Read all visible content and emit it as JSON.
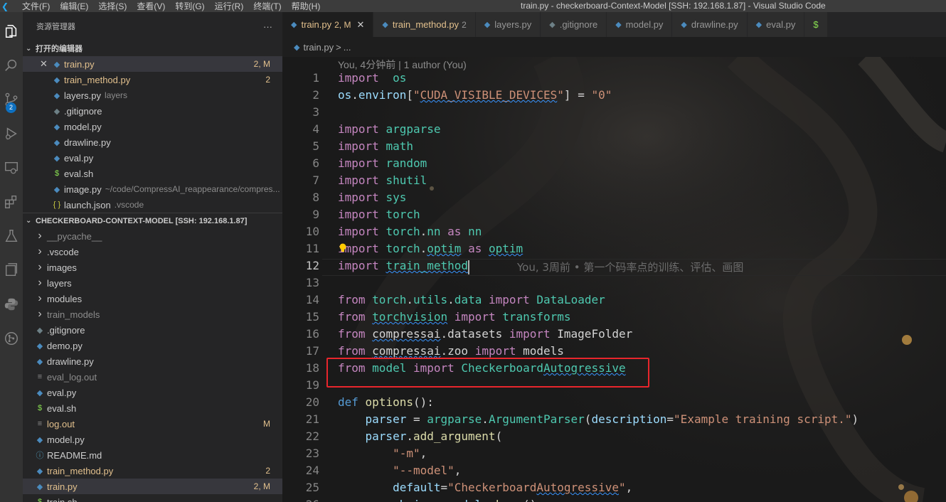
{
  "titlebar": {
    "logo": "vscode-logo",
    "menu": [
      "文件(F)",
      "编辑(E)",
      "选择(S)",
      "查看(V)",
      "转到(G)",
      "运行(R)",
      "终端(T)",
      "帮助(H)"
    ],
    "window_title": "train.py - checkerboard-Context-Model [SSH: 192.168.1.87] - Visual Studio Code"
  },
  "activity": {
    "icons": [
      "files-icon",
      "search-icon",
      "source-control-icon",
      "run-debug-icon",
      "remote-explorer-icon",
      "extensions-icon",
      "testing-icon",
      "jupyter-icon",
      "python-icon",
      "gitlens-icon"
    ],
    "scm_badge": "2"
  },
  "sidebar": {
    "title": "资源管理器",
    "more": "···",
    "open_editors_title": "打开的编辑器",
    "open_editors": [
      {
        "name": "train.py",
        "desc": "",
        "status": "2, M",
        "kind": "py",
        "color": "mod",
        "close": "✕",
        "selected": true
      },
      {
        "name": "train_method.py",
        "desc": "",
        "status": "2",
        "kind": "py",
        "color": "mod"
      },
      {
        "name": "layers.py",
        "desc": "layers",
        "status": "",
        "kind": "py",
        "color": ""
      },
      {
        "name": ".gitignore",
        "desc": "",
        "status": "",
        "kind": "git",
        "color": ""
      },
      {
        "name": "model.py",
        "desc": "",
        "status": "",
        "kind": "py",
        "color": ""
      },
      {
        "name": "drawline.py",
        "desc": "",
        "status": "",
        "kind": "py",
        "color": ""
      },
      {
        "name": "eval.py",
        "desc": "",
        "status": "",
        "kind": "py",
        "color": ""
      },
      {
        "name": "eval.sh",
        "desc": "",
        "status": "",
        "kind": "sh",
        "color": ""
      },
      {
        "name": "image.py",
        "desc": "~/code/CompressAI_reappearance/compres...",
        "status": "",
        "kind": "py",
        "color": ""
      },
      {
        "name": "launch.json",
        "desc": ".vscode",
        "status": "",
        "kind": "json",
        "color": ""
      }
    ],
    "workspace_title": "CHECKERBOARD-CONTEXT-MODEL [SSH: 192.168.1.87]",
    "workspace": [
      {
        "name": "__pycache__",
        "kind": "folder",
        "color": "dim",
        "status": ""
      },
      {
        "name": ".vscode",
        "kind": "folder",
        "color": "",
        "status": ""
      },
      {
        "name": "images",
        "kind": "folder",
        "color": "",
        "status": ""
      },
      {
        "name": "layers",
        "kind": "folder",
        "color": "",
        "status": ""
      },
      {
        "name": "modules",
        "kind": "folder",
        "color": "",
        "status": ""
      },
      {
        "name": "train_models",
        "kind": "folder",
        "color": "dim",
        "status": ""
      },
      {
        "name": ".gitignore",
        "kind": "git",
        "color": "",
        "status": ""
      },
      {
        "name": "demo.py",
        "kind": "py",
        "color": "",
        "status": ""
      },
      {
        "name": "drawline.py",
        "kind": "py",
        "color": "",
        "status": ""
      },
      {
        "name": "eval_log.out",
        "kind": "txt",
        "color": "dim",
        "status": ""
      },
      {
        "name": "eval.py",
        "kind": "py",
        "color": "",
        "status": ""
      },
      {
        "name": "eval.sh",
        "kind": "sh",
        "color": "",
        "status": ""
      },
      {
        "name": "log.out",
        "kind": "txt",
        "color": "mod",
        "status": "M"
      },
      {
        "name": "model.py",
        "kind": "py",
        "color": "",
        "status": ""
      },
      {
        "name": "README.md",
        "kind": "info",
        "color": "",
        "status": ""
      },
      {
        "name": "train_method.py",
        "kind": "py",
        "color": "mod",
        "status": "2"
      },
      {
        "name": "train.py",
        "kind": "py",
        "color": "mod",
        "status": "2, M",
        "selected": true
      },
      {
        "name": "train.sh",
        "kind": "sh",
        "color": "",
        "status": ""
      }
    ]
  },
  "tabs": [
    {
      "label": "train.py",
      "status": "2, M",
      "close": "✕",
      "kind": "py",
      "active": true
    },
    {
      "label": "train_method.py",
      "status": "2",
      "kind": "py"
    },
    {
      "label": "layers.py",
      "status": "",
      "kind": "py"
    },
    {
      "label": ".gitignore",
      "status": "",
      "kind": "git"
    },
    {
      "label": "model.py",
      "status": "",
      "kind": "py"
    },
    {
      "label": "drawline.py",
      "status": "",
      "kind": "py"
    },
    {
      "label": "eval.py",
      "status": "",
      "kind": "py"
    },
    {
      "label": "$",
      "status": "",
      "kind": "sh"
    }
  ],
  "breadcrumb": {
    "file": "train.py",
    "sep": ">",
    "rest": "..."
  },
  "editor": {
    "codelens": "You, 4分钟前 | 1 author (You)",
    "blame": "You, 3周前 • 第一个码率点的训练、评估、画图",
    "current_line": 12,
    "lines": [
      {
        "n": "1",
        "t": [
          [
            "kw",
            "import"
          ],
          [
            "",
            "  "
          ],
          [
            "mod-n",
            "os"
          ]
        ]
      },
      {
        "n": "2",
        "t": [
          [
            "var",
            "os"
          ],
          [
            "",
            "."
          ],
          [
            "var",
            "environ"
          ],
          [
            "",
            "["
          ],
          [
            "str",
            "\""
          ],
          [
            "str sq",
            "CUDA_VISIBLE_DEVICES"
          ],
          [
            "str",
            "\""
          ],
          [
            "",
            "] = "
          ],
          [
            "str",
            "\"0\""
          ]
        ]
      },
      {
        "n": "3",
        "t": []
      },
      {
        "n": "4",
        "t": [
          [
            "kw",
            "import"
          ],
          [
            "",
            " "
          ],
          [
            "mod-n",
            "argparse"
          ]
        ]
      },
      {
        "n": "5",
        "t": [
          [
            "kw",
            "import"
          ],
          [
            "",
            " "
          ],
          [
            "mod-n",
            "math"
          ]
        ]
      },
      {
        "n": "6",
        "t": [
          [
            "kw",
            "import"
          ],
          [
            "",
            " "
          ],
          [
            "mod-n",
            "random"
          ]
        ]
      },
      {
        "n": "7",
        "t": [
          [
            "kw",
            "import"
          ],
          [
            "",
            " "
          ],
          [
            "mod-n",
            "shutil"
          ]
        ]
      },
      {
        "n": "8",
        "t": [
          [
            "kw",
            "import"
          ],
          [
            "",
            " "
          ],
          [
            "mod-n",
            "sys"
          ]
        ]
      },
      {
        "n": "9",
        "t": [
          [
            "kw",
            "import"
          ],
          [
            "",
            " "
          ],
          [
            "mod-n",
            "torch"
          ]
        ]
      },
      {
        "n": "10",
        "t": [
          [
            "kw",
            "import"
          ],
          [
            "",
            " "
          ],
          [
            "mod-n",
            "torch"
          ],
          [
            "",
            "."
          ],
          [
            "mod-n",
            "nn"
          ],
          [
            "",
            " "
          ],
          [
            "kw",
            "as"
          ],
          [
            "",
            " "
          ],
          [
            "mod-n",
            "nn"
          ]
        ]
      },
      {
        "n": "11",
        "t": [
          [
            "kw",
            "import"
          ],
          [
            "",
            " "
          ],
          [
            "mod-n",
            "torch"
          ],
          [
            "",
            "."
          ],
          [
            "mod-n sq",
            "optim"
          ],
          [
            "",
            " "
          ],
          [
            "kw",
            "as"
          ],
          [
            "",
            " "
          ],
          [
            "mod-n sq",
            "optim"
          ]
        ]
      },
      {
        "n": "12",
        "t": [
          [
            "kw",
            "import"
          ],
          [
            "",
            " "
          ],
          [
            "mod-n sq",
            "train_method"
          ]
        ]
      },
      {
        "n": "13",
        "t": []
      },
      {
        "n": "14",
        "t": [
          [
            "kw",
            "from"
          ],
          [
            "",
            " "
          ],
          [
            "mod-n",
            "torch"
          ],
          [
            "",
            "."
          ],
          [
            "mod-n",
            "utils"
          ],
          [
            "",
            "."
          ],
          [
            "mod-n",
            "data"
          ],
          [
            "",
            " "
          ],
          [
            "kw",
            "import"
          ],
          [
            "",
            " "
          ],
          [
            "mod-n",
            "DataLoader"
          ]
        ]
      },
      {
        "n": "15",
        "t": [
          [
            "kw",
            "from"
          ],
          [
            "",
            " "
          ],
          [
            "mod-n sq",
            "torchvision"
          ],
          [
            "",
            " "
          ],
          [
            "kw",
            "import"
          ],
          [
            "",
            " "
          ],
          [
            "mod-n",
            "transforms"
          ]
        ]
      },
      {
        "n": "16",
        "t": [
          [
            "kw",
            "from"
          ],
          [
            "",
            " "
          ],
          [
            "sq",
            "compressai"
          ],
          [
            "",
            "."
          ],
          [
            "",
            "datasets"
          ],
          [
            "",
            " "
          ],
          [
            "kw",
            "import"
          ],
          [
            "",
            " ImageFolder"
          ]
        ]
      },
      {
        "n": "17",
        "t": [
          [
            "kw",
            "from"
          ],
          [
            "",
            " "
          ],
          [
            "sq",
            "compressai"
          ],
          [
            "",
            "."
          ],
          [
            "",
            "zoo"
          ],
          [
            "",
            " "
          ],
          [
            "kw",
            "import"
          ],
          [
            "",
            " models"
          ]
        ]
      },
      {
        "n": "18",
        "t": [
          [
            "kw",
            "from"
          ],
          [
            "",
            " "
          ],
          [
            "mod-n",
            "model"
          ],
          [
            "",
            " "
          ],
          [
            "kw",
            "import"
          ],
          [
            "",
            " "
          ],
          [
            "mod-n",
            "Checkerboard"
          ],
          [
            "mod-n sq",
            "Autogressive"
          ]
        ]
      },
      {
        "n": "19",
        "t": []
      },
      {
        "n": "20",
        "t": [
          [
            "kw2",
            "def"
          ],
          [
            "",
            " "
          ],
          [
            "fn",
            "options"
          ],
          [
            "",
            "():"
          ]
        ]
      },
      {
        "n": "21",
        "t": [
          [
            "",
            "    "
          ],
          [
            "var",
            "parser"
          ],
          [
            "",
            " = "
          ],
          [
            "mod-n",
            "argparse"
          ],
          [
            "",
            "."
          ],
          [
            "mod-n",
            "ArgumentParser"
          ],
          [
            "",
            "("
          ],
          [
            "var",
            "description"
          ],
          [
            "",
            "="
          ],
          [
            "str",
            "\"Example training script.\""
          ],
          [
            "",
            ")"
          ]
        ]
      },
      {
        "n": "22",
        "t": [
          [
            "",
            "    "
          ],
          [
            "var",
            "parser"
          ],
          [
            "",
            "."
          ],
          [
            "fn",
            "add_argument"
          ],
          [
            "",
            "("
          ]
        ]
      },
      {
        "n": "23",
        "t": [
          [
            "",
            "        "
          ],
          [
            "str",
            "\"-m\""
          ],
          [
            "",
            ","
          ]
        ]
      },
      {
        "n": "24",
        "t": [
          [
            "",
            "        "
          ],
          [
            "str",
            "\"--model\""
          ],
          [
            "",
            ","
          ]
        ]
      },
      {
        "n": "25",
        "t": [
          [
            "",
            "        "
          ],
          [
            "var",
            "default"
          ],
          [
            "",
            "="
          ],
          [
            "str",
            "\"Checkerboard"
          ],
          [
            "str sq",
            "Autogressive"
          ],
          [
            "str",
            "\""
          ],
          [
            "",
            ","
          ]
        ]
      },
      {
        "n": "26",
        "t": [
          [
            "",
            "        "
          ],
          [
            "var",
            "choices"
          ],
          [
            "",
            "="
          ],
          [
            "var",
            "models"
          ],
          [
            "",
            "."
          ],
          [
            "fn",
            "keys"
          ],
          [
            "",
            "(),"
          ]
        ]
      }
    ]
  }
}
